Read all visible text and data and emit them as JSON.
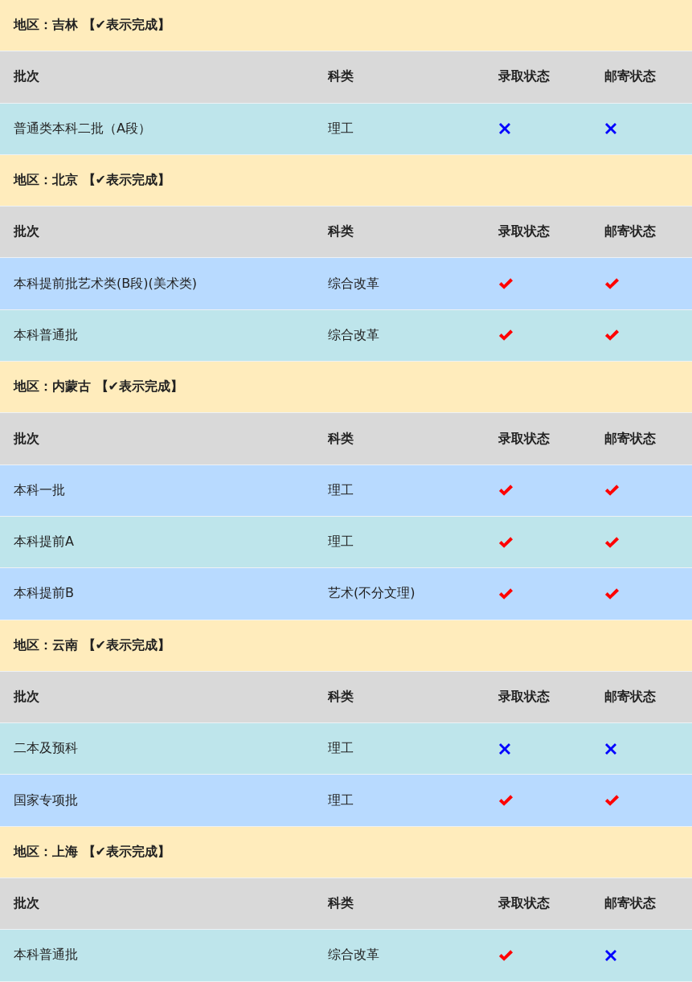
{
  "sections": [
    {
      "title": "地区：吉林 【✔表示完成】",
      "columns": [
        "批次",
        "科类",
        "录取状态",
        "邮寄状态"
      ],
      "rows": [
        {
          "batch": "普通类本科二批（A段）",
          "category": "理工",
          "admitted": false,
          "mailed": false,
          "color": "#bee5eb"
        }
      ]
    },
    {
      "title": "地区：北京 【✔表示完成】",
      "columns": [
        "批次",
        "科类",
        "录取状态",
        "邮寄状态"
      ],
      "rows": [
        {
          "batch": "本科提前批艺术类(B段)(美术类)",
          "category": "综合改革",
          "admitted": true,
          "mailed": true,
          "color": "#b8daff"
        },
        {
          "batch": "本科普通批",
          "category": "综合改革",
          "admitted": true,
          "mailed": true,
          "color": "#bee5eb"
        }
      ]
    },
    {
      "title": "地区：内蒙古 【✔表示完成】",
      "columns": [
        "批次",
        "科类",
        "录取状态",
        "邮寄状态"
      ],
      "rows": [
        {
          "batch": "本科一批",
          "category": "理工",
          "admitted": true,
          "mailed": true,
          "color": "#b8daff"
        },
        {
          "batch": "本科提前A",
          "category": "理工",
          "admitted": true,
          "mailed": true,
          "color": "#bee5eb"
        },
        {
          "batch": "本科提前B",
          "category": "艺术(不分文理)",
          "admitted": true,
          "mailed": true,
          "color": "#b8daff"
        }
      ]
    },
    {
      "title": "地区：云南 【✔表示完成】",
      "columns": [
        "批次",
        "科类",
        "录取状态",
        "邮寄状态"
      ],
      "rows": [
        {
          "batch": "二本及预科",
          "category": "理工",
          "admitted": false,
          "mailed": false,
          "color": "#bee5eb"
        },
        {
          "batch": "国家专项批",
          "category": "理工",
          "admitted": true,
          "mailed": true,
          "color": "#b8daff"
        }
      ]
    },
    {
      "title": "地区：上海 【✔表示完成】",
      "columns": [
        "批次",
        "科类",
        "录取状态",
        "邮寄状态"
      ],
      "rows": [
        {
          "batch": "本科普通批",
          "category": "综合改革",
          "admitted": true,
          "mailed": false,
          "color": "#bee5eb"
        }
      ]
    }
  ]
}
